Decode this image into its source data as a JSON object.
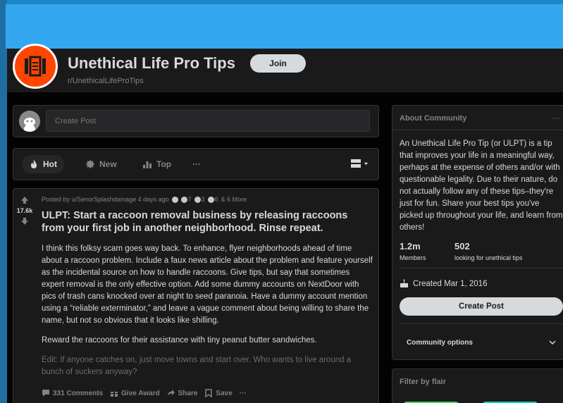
{
  "subreddit": {
    "title": "Unethical Life Pro Tips",
    "name": "r/UnethicalLifeProTips",
    "join_label": "Join"
  },
  "create_post": {
    "placeholder": "Create Post"
  },
  "sort": {
    "hot": "Hot",
    "new": "New",
    "top": "Top",
    "more": "···"
  },
  "post": {
    "score": "17.6k",
    "meta": "Posted by u/SenorSplashdamage 4 days ago",
    "awards": [
      {
        "icon": "award-icon-1",
        "count": "",
        "color": "#c9c9c9"
      },
      {
        "icon": "award-icon-2",
        "count": "7",
        "color": "#c9c9c9"
      },
      {
        "icon": "award-icon-3",
        "count": "3",
        "color": "#c9c9c9"
      },
      {
        "icon": "award-icon-4",
        "count": "6",
        "color": "#c9c9c9"
      }
    ],
    "awards_more": "& 6 More",
    "title": "ULPT: Start a raccoon removal business by releasing raccoons from your first job in another neighborhood. Rinse repeat.",
    "body": [
      "I think this folksy scam goes way back. To enhance, flyer neighborhoods ahead of time about a raccoon problem. Include a faux news article about the problem and feature yourself as the incidental source on how to handle raccoons. Give tips, but say that sometimes expert removal is the only effective option. Add some dummy accounts on NextDoor with pics of trash cans knocked over at night to seed paranoia. Have a dummy account mention using a “reliable exterminator,” and leave a vague comment about being willing to share the name, but not so obvious that it looks like shilling.",
      "Reward the raccoons for their assistance with tiny peanut butter sandwiches.",
      "Edit: If anyone catches on, just move towns and start over. Who wants to live around a bunch of suckers anyway?"
    ],
    "comments_label": "331 Comments",
    "give_award_label": "Give Award",
    "share_label": "Share",
    "save_label": "Save",
    "more_label": "···"
  },
  "about": {
    "heading": "About Community",
    "more": "···",
    "description": "An Unethical Life Pro Tip (or ULPT) is a tip that improves your life in a meaningful way, perhaps at the expense of others and/or with questionable legality. Due to their nature, do not actually follow any of these tips–they're just for fun. Share your best tips you've picked up throughout your life, and learn from others!",
    "members_count": "1.2m",
    "members_label": "Members",
    "online_count": "502",
    "online_label": "looking for unethical tips",
    "created": "Created Mar 1, 2016",
    "create_post_label": "Create Post",
    "community_options_label": "Community options"
  },
  "flair": {
    "heading": "Filter by flair"
  },
  "colors": {
    "brand": "#ff4500",
    "banner": "#33a8f0",
    "page_bg": "#030303",
    "card_bg": "#1a1a1b"
  }
}
